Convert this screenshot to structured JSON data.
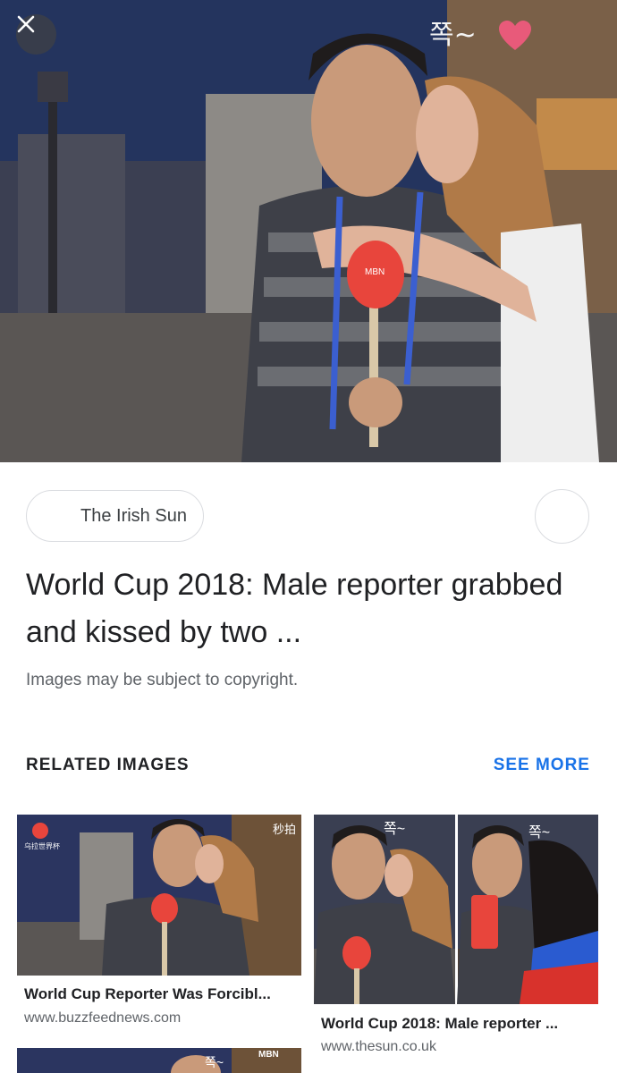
{
  "hero": {
    "close_icon": "close-icon",
    "sticker_text": "쪽~",
    "mic_label": "MBN"
  },
  "source": {
    "name": "The Irish Sun"
  },
  "result": {
    "title": "World Cup 2018: Male reporter grabbed and kissed by two ...",
    "copyright_note": "Images may be subject to copyright."
  },
  "related": {
    "heading": "RELATED IMAGES",
    "see_more": "SEE MORE",
    "items": [
      {
        "title": "World Cup Reporter Was Forcibl...",
        "site": "www.buzzfeednews.com"
      },
      {
        "title": "World Cup 2018: Male reporter ...",
        "site": "www.thesun.co.uk"
      }
    ],
    "thumb_badges": [
      "乌拉世界杯",
      "MBN",
      "秒拍"
    ]
  },
  "colors": {
    "accent": "#1a73e8",
    "heart": "#e85a7a",
    "mic": "#e8453c"
  }
}
